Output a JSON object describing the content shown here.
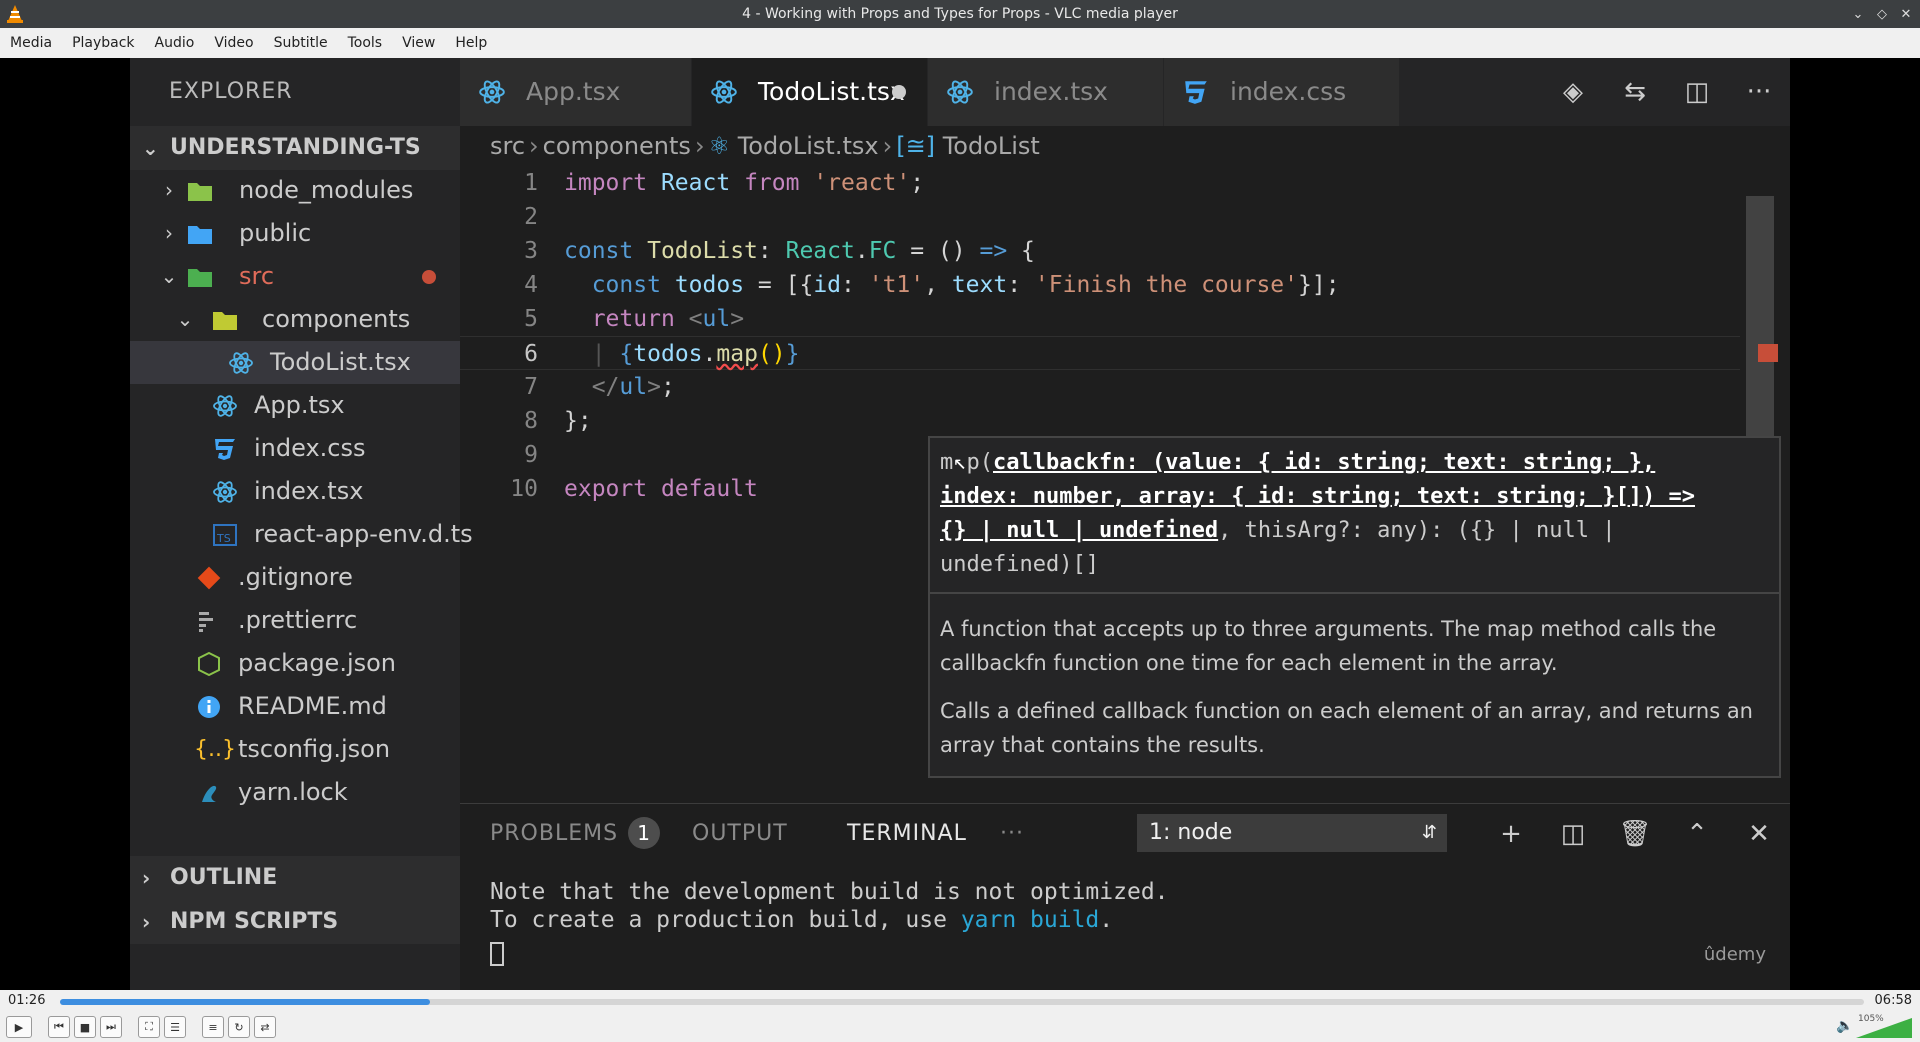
{
  "window": {
    "title": "4 - Working with Props and Types for Props - VLC media player"
  },
  "menu": [
    "Media",
    "Playback",
    "Audio",
    "Video",
    "Subtitle",
    "Tools",
    "View",
    "Help"
  ],
  "vscode": {
    "explorer_title": "EXPLORER",
    "project": "UNDERSTANDING-TS",
    "tree": [
      {
        "label": "node_modules",
        "icon": "folder-node-icon"
      },
      {
        "label": "public",
        "icon": "folder-public-icon"
      },
      {
        "label": "src",
        "icon": "folder-src-icon"
      },
      {
        "label": "components",
        "icon": "folder-components-icon"
      },
      {
        "label": "TodoList.tsx",
        "icon": "react-icon"
      },
      {
        "label": "App.tsx",
        "icon": "react-icon"
      },
      {
        "label": "index.css",
        "icon": "css-icon"
      },
      {
        "label": "index.tsx",
        "icon": "react-icon"
      },
      {
        "label": "react-app-env.d.ts",
        "icon": "ts-icon"
      },
      {
        "label": ".gitignore",
        "icon": "git-icon"
      },
      {
        "label": ".prettierrc",
        "icon": "prettier-icon"
      },
      {
        "label": "package.json",
        "icon": "node-icon"
      },
      {
        "label": "README.md",
        "icon": "info-icon"
      },
      {
        "label": "tsconfig.json",
        "icon": "json-icon"
      },
      {
        "label": "yarn.lock",
        "icon": "yarn-icon"
      }
    ],
    "outline": "OUTLINE",
    "npm_scripts": "NPM SCRIPTS",
    "tabs": [
      "App.tsx",
      "TodoList.tsx",
      "index.tsx",
      "index.css"
    ],
    "breadcrumb": [
      "src",
      "components",
      "TodoList.tsx",
      "TodoList"
    ],
    "line_numbers": [
      "1",
      "2",
      "3",
      "4",
      "5",
      "6",
      "7",
      "8",
      "9",
      "10"
    ],
    "hover": {
      "sig_1": "m",
      "sig_2": "p(",
      "sig_param_1": "callbackfn: (value: { id: string; text: string; },",
      "sig_param_2": "index: number, array: { id: string; text: string; }[]) =>",
      "sig_param_3": "{} | null | undefined",
      "sig_rest_1": ", thisArg?: any): ({} | null |",
      "sig_rest_2": "undefined)[]",
      "doc_1": "A function that accepts up to three arguments. The map method calls the callbackfn function one time for each element in the array.",
      "doc_2": "Calls a defined callback function on each element of an array, and returns an array that contains the results."
    },
    "panel": {
      "problems": "PROBLEMS",
      "problems_count": "1",
      "output": "OUTPUT",
      "terminal": "TERMINAL",
      "more": "···",
      "terminal_select": "1: node",
      "line_1": "Note that the development build is not optimized.",
      "line_2a": "To create a production build, use ",
      "line_2b": "yarn build",
      "line_2c": "."
    },
    "watermark": "ûdemy"
  },
  "player": {
    "elapsed": "01:26",
    "total": "06:58",
    "progress": 0.205,
    "volume": "105%"
  }
}
